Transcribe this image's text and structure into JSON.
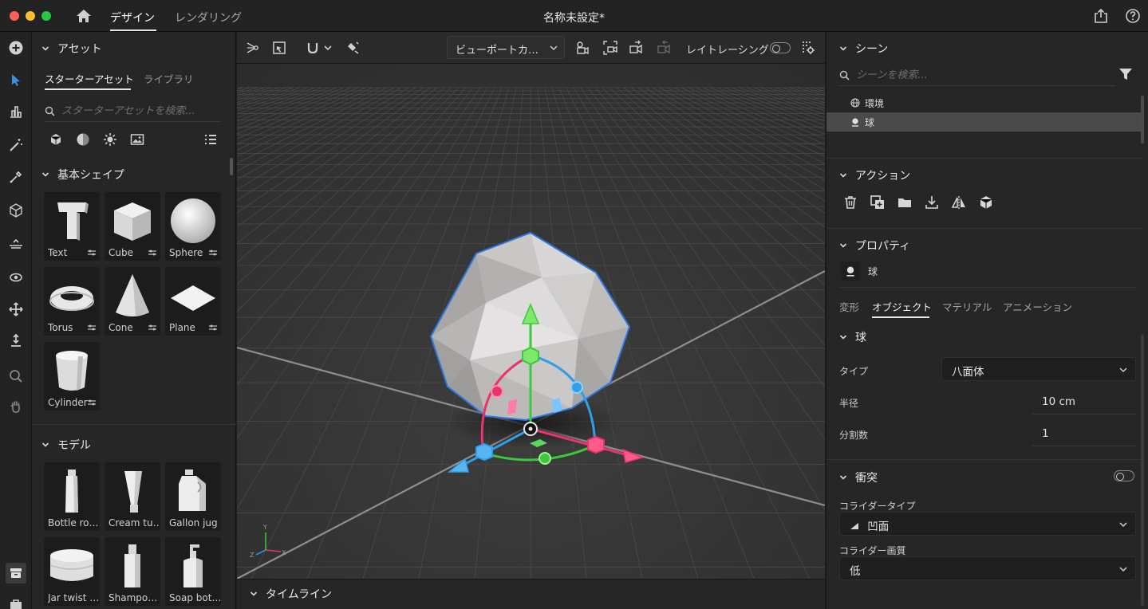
{
  "app": {
    "doc_title": "名称未設定*",
    "tabs": [
      "デザイン",
      "レンダリング"
    ]
  },
  "assets": {
    "section_title": "アセット",
    "sub_tabs": [
      "スターターアセット",
      "ライブラリ"
    ],
    "search_placeholder": "スターターアセットを検索...",
    "basic_shapes": {
      "title": "基本シェイプ",
      "items": [
        "Text",
        "Cube",
        "Sphere",
        "Torus",
        "Cone",
        "Plane",
        "Cylinder"
      ]
    },
    "models": {
      "title": "モデル",
      "items": [
        "Bottle ro…",
        "Cream tu…",
        "Gallon jug",
        "Jar twist …",
        "Shampo…",
        "Soap bot…"
      ]
    }
  },
  "viewport_toolbar": {
    "camera_dropdown": "ビューポートカ…",
    "raytracing_label": "レイトレーシング",
    "raytracing_on": false
  },
  "viewport": {
    "axis_labels": [
      "Y",
      "Z",
      "X"
    ]
  },
  "timeline": {
    "title": "タイムライン"
  },
  "scene": {
    "title": "シーン",
    "search_placeholder": "シーンを検索...",
    "tree": [
      {
        "label": "環境",
        "icon": "globe-icon",
        "selected": false
      },
      {
        "label": "球",
        "icon": "object-icon",
        "selected": true
      }
    ]
  },
  "actions": {
    "title": "アクション",
    "icons": [
      "trash-icon",
      "duplicate-icon",
      "folder-icon",
      "download-icon",
      "mirror-icon",
      "box-icon"
    ]
  },
  "properties": {
    "title": "プロパティ",
    "object_name": "球",
    "tabs": [
      "変形",
      "オブジェクト",
      "マテリアル",
      "アニメーション"
    ],
    "active_tab": "オブジェクト",
    "sphere": {
      "title": "球",
      "type_label": "タイプ",
      "type_value": "八面体",
      "radius_label": "半径",
      "radius_value": "10 cm",
      "subdiv_label": "分割数",
      "subdiv_value": "1"
    },
    "collision": {
      "title": "衝突",
      "enabled": false,
      "collider_type_label": "コライダータイプ",
      "collider_type_value": "凹面",
      "collider_quality_label": "コライダー画質",
      "collider_quality_value": "低"
    }
  },
  "colors": {
    "accent_blue": "#2d8ceb",
    "gizmo_green": "#3cc83c",
    "gizmo_red": "#e8336e",
    "gizmo_blue": "#2f9fe8",
    "selection_outline": "#2a78e0"
  }
}
